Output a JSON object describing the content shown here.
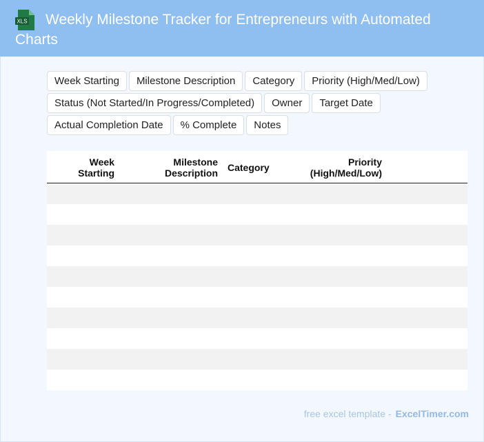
{
  "header": {
    "icon": "xls-file-icon",
    "icon_text": "XLS",
    "title": "Weekly Milestone Tracker for Entrepreneurs with Automated Charts"
  },
  "fields": [
    "Week Starting",
    "Milestone Description",
    "Category",
    "Priority (High/Med/Low)",
    "Status (Not Started/In Progress/Completed)",
    "Owner",
    "Target Date",
    "Actual Completion Date",
    "% Complete",
    "Notes"
  ],
  "table": {
    "columns": [
      {
        "label": "Week\nStarting"
      },
      {
        "label": "Milestone\nDescription"
      },
      {
        "label": "Category"
      },
      {
        "label": "Priority\n(High/Med/Low)"
      }
    ],
    "rows": [
      [],
      [],
      [],
      [],
      [],
      [],
      [],
      [],
      [],
      []
    ]
  },
  "footer": {
    "text": "free excel template -",
    "brand": "ExcelTimer.com"
  },
  "colors": {
    "header_bg": "#8fbff0",
    "page_bg": "#f3f8ff",
    "icon_green": "#1f7a45"
  }
}
